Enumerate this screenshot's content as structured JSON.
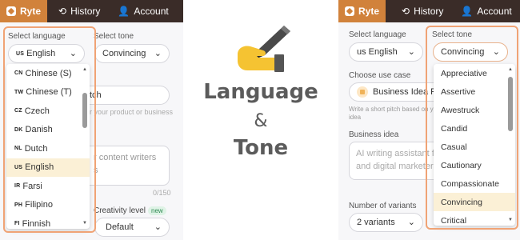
{
  "nav": {
    "brand": "Ryte",
    "history": "History",
    "account": "Account"
  },
  "left": {
    "select_language_label": "Select language",
    "select_tone_label": "Select tone",
    "tone_value": "Convincing",
    "use_case_value_fragment": "tch",
    "use_case_hint_fragment": "r your product or business",
    "textarea_fragment_1": "r content writers",
    "textarea_fragment_2": "s",
    "counter": "0/150",
    "creativity_label": "Creativity level",
    "new_badge": "new",
    "creativity_value": "Default",
    "language_options": [
      {
        "code": "CN",
        "name": "Chinese (S)"
      },
      {
        "code": "TW",
        "name": "Chinese (T)"
      },
      {
        "code": "CZ",
        "name": "Czech"
      },
      {
        "code": "DK",
        "name": "Danish"
      },
      {
        "code": "NL",
        "name": "Dutch"
      },
      {
        "code": "US",
        "name": "English"
      },
      {
        "code": "IR",
        "name": "Farsi"
      },
      {
        "code": "PH",
        "name": "Filipino"
      },
      {
        "code": "FI",
        "name": "Finnish"
      }
    ],
    "selected_language": {
      "code": "US",
      "name": "English"
    }
  },
  "center": {
    "line1": "Language",
    "line2": "&",
    "line3": "Tone",
    "icon": "writing-hand-icon"
  },
  "right": {
    "select_language_label": "Select language",
    "select_tone_label": "Select tone",
    "language_value": "us English",
    "tone_value": "Convincing",
    "use_case_label": "Choose use case",
    "use_case_value": "Business Idea Pit",
    "use_case_hint": "Write a short pitch based on yo",
    "use_case_hint_2": "idea",
    "business_idea_label": "Business idea",
    "business_idea_text_1": "AI writing assistant fo",
    "business_idea_text_2": "and digital marketers",
    "variants_label": "Number of variants",
    "variants_value": "2 variants",
    "tone_options": [
      "Appreciative",
      "Assertive",
      "Awestruck",
      "Candid",
      "Casual",
      "Cautionary",
      "Compassionate",
      "Convincing",
      "Critical"
    ],
    "selected_tone": "Convincing"
  },
  "colors": {
    "nav_bg": "#3a2c28",
    "brand_accent": "#d1823b",
    "highlight_border": "#f0a375",
    "selected_row": "#fbf0d6",
    "hand_yellow": "#f5c332"
  }
}
